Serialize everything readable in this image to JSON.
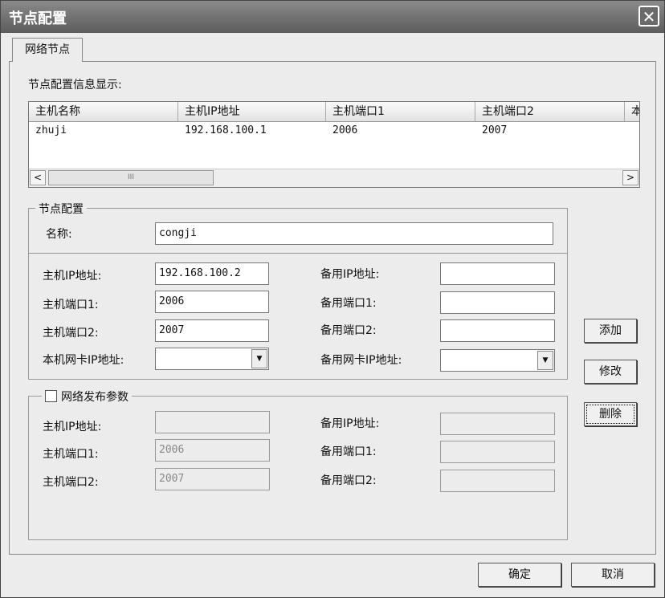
{
  "window": {
    "title": "节点配置"
  },
  "tab": {
    "label": "网络节点"
  },
  "list": {
    "caption": "节点配置信息显示:",
    "columns": [
      "主机名称",
      "主机IP地址",
      "主机端口1",
      "主机端口2",
      "本"
    ],
    "rows": [
      [
        "zhuji",
        "192.168.100.1",
        "2006",
        "2007"
      ]
    ],
    "scroll_thumb": "III"
  },
  "node_config": {
    "title": "节点配置",
    "name_label": "名称:",
    "name_value": "congji",
    "host_ip_label": "主机IP地址:",
    "host_ip_value": "192.168.100.2",
    "host_port1_label": "主机端口1:",
    "host_port1_value": "2006",
    "host_port2_label": "主机端口2:",
    "host_port2_value": "2007",
    "local_nic_label": "本机网卡IP地址:",
    "local_nic_value": "",
    "backup_ip_label": "备用IP地址:",
    "backup_ip_value": "",
    "backup_port1_label": "备用端口1:",
    "backup_port1_value": "",
    "backup_port2_label": "备用端口2:",
    "backup_port2_value": "",
    "backup_nic_label": "备用网卡IP地址:",
    "backup_nic_value": ""
  },
  "publish": {
    "title": "网络发布参数",
    "checked": false,
    "host_ip_label": "主机IP地址:",
    "host_ip_value": "",
    "host_port1_label": "主机端口1:",
    "host_port1_value": "2006",
    "host_port2_label": "主机端口2:",
    "host_port2_value": "2007",
    "backup_ip_label": "备用IP地址:",
    "backup_ip_value": "",
    "backup_port1_label": "备用端口1:",
    "backup_port1_value": "",
    "backup_port2_label": "备用端口2:",
    "backup_port2_value": ""
  },
  "buttons": {
    "add": "添加",
    "modify": "修改",
    "delete": "删除",
    "ok": "确定",
    "cancel": "取消"
  }
}
